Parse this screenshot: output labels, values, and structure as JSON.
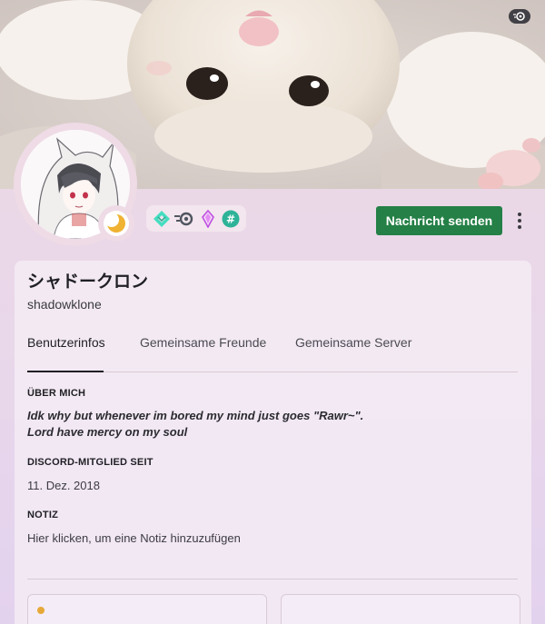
{
  "profile": {
    "display_name": "シャドークロン",
    "username": "shadowklone",
    "banner_badge_icon": "nitro-icon",
    "status_icon": "idle-moon-icon",
    "badges": [
      "hypesquad-balance-icon",
      "nitro-icon",
      "boost-gem-icon",
      "hashtag-icon"
    ]
  },
  "actions": {
    "message_label": "Nachricht senden",
    "more_icon": "more-vertical-icon"
  },
  "tabs": [
    {
      "label": "Benutzerinfos",
      "active": true
    },
    {
      "label": "Gemeinsame Freunde",
      "active": false
    },
    {
      "label": "Gemeinsame Server",
      "active": false
    }
  ],
  "about": {
    "heading": "ÜBER MICH",
    "lines": [
      "Idk why but whenever im bored my mind just goes \"Rawr~\".",
      "Lord have mercy on my soul"
    ]
  },
  "member_since": {
    "heading": "DISCORD-MITGLIED SEIT",
    "date": "11. Dez. 2018"
  },
  "note": {
    "heading": "NOTIZ",
    "placeholder": "Hier klicken, um eine Notiz hinzuzufügen"
  },
  "colors": {
    "accent_green": "#248046",
    "banner_bg": "#efe7e2",
    "card_bg": "#f7f0f6",
    "status_idle": "#f0b232"
  }
}
